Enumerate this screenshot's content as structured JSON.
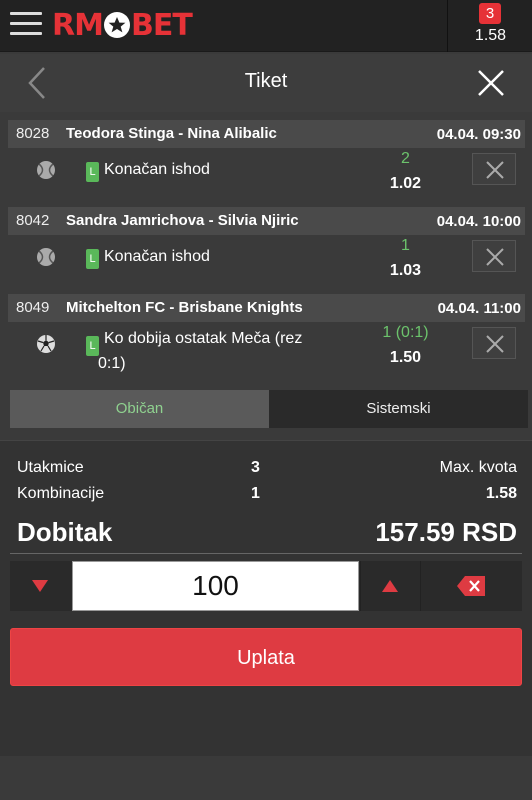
{
  "brand": {
    "logo_left": "RM",
    "logo_right": "BET",
    "accent": "#e63237"
  },
  "topbar": {
    "badge_count": "3",
    "badge_odds": "1.58",
    "menu_icon": "hamburger-icon"
  },
  "header": {
    "title": "Tiket",
    "back_icon": "chevron-left-icon",
    "close_icon": "close-icon"
  },
  "events": [
    {
      "code": "8028",
      "name": "Teodora Stinga - Nina Alibalic",
      "time": "04.04. 09:30",
      "sport_icon": "tennis-icon",
      "live": "L",
      "market": "Konačan ishod",
      "pick": "2",
      "odd": "1.02"
    },
    {
      "code": "8042",
      "name": "Sandra Jamrichova - Silvia Njiric",
      "time": "04.04. 10:00",
      "sport_icon": "tennis-icon",
      "live": "L",
      "market": "Konačan ishod",
      "pick": "1",
      "odd": "1.03"
    },
    {
      "code": "8049",
      "name": "Mitchelton FC - Brisbane Knights",
      "time": "04.04. 11:00",
      "sport_icon": "soccer-icon",
      "live": "L",
      "market": "Ko dobija ostatak Meča (rez 0:1)",
      "pick": "1 (0:1)",
      "odd": "1.50"
    }
  ],
  "tabs": {
    "single": "Običan",
    "system": "Sistemski"
  },
  "summary": {
    "matches_label": "Utakmice",
    "matches_value": "3",
    "max_odds_label": "Max. kvota",
    "combinations_label": "Kombinacije",
    "combinations_value": "1",
    "max_odds_value": "1.58",
    "payout_label": "Dobitak",
    "payout_value": "157.59 RSD"
  },
  "stake": {
    "value": "100"
  },
  "pay_button": "Uplata"
}
